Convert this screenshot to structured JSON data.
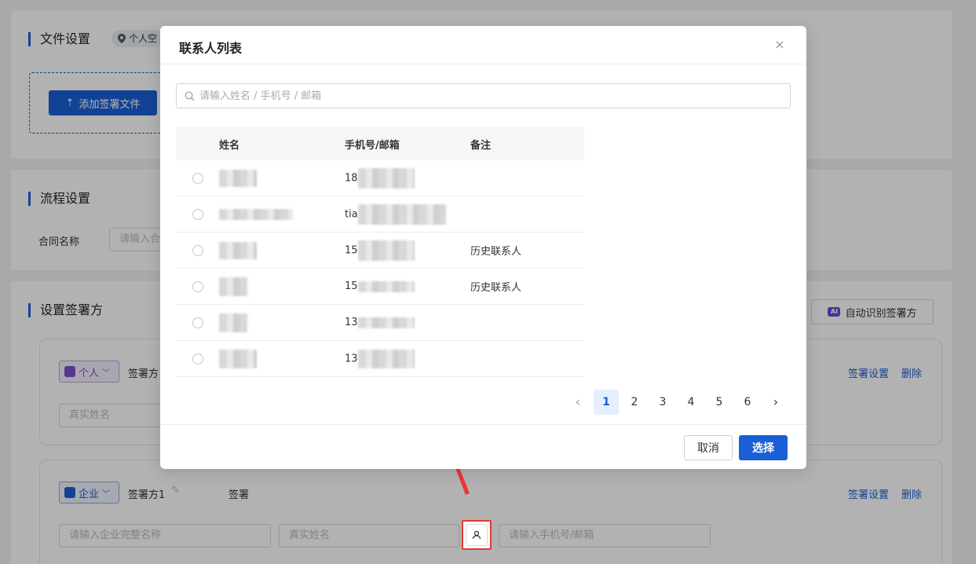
{
  "background": {
    "file_settings": {
      "title": "文件设置",
      "location_tag": "个人空",
      "add_file_button": "添加签署文件"
    },
    "flow_settings": {
      "title": "流程设置",
      "contract_name_label": "合同名称",
      "contract_name_placeholder": "请输入合"
    },
    "signers": {
      "title": "设置签署方",
      "auto_detect_button": "自动识别签署方",
      "ai_badge": "AI",
      "person_block": {
        "type": "个人",
        "label": "签署方",
        "name_placeholder": "真实姓名",
        "settings_link": "签署设置",
        "delete_link": "删除"
      },
      "company_block": {
        "type": "企业",
        "label": "签署方1",
        "sign_label": "签署",
        "company_placeholder": "请输入企业完整名称",
        "name_placeholder": "真实姓名",
        "contact_placeholder": "请输入手机号/邮箱",
        "settings_link": "签署设置",
        "delete_link": "删除"
      }
    }
  },
  "modal": {
    "title": "联系人列表",
    "close": "×",
    "search_placeholder": "请输入姓名 / 手机号 / 邮箱",
    "columns": [
      "姓名",
      "手机号/邮箱",
      "备注"
    ],
    "rows": [
      {
        "phone_prefix": "18",
        "note": ""
      },
      {
        "phone_prefix": "tia",
        "note": ""
      },
      {
        "phone_prefix": "15",
        "note": "历史联系人"
      },
      {
        "phone_prefix": "15",
        "note": "历史联系人"
      },
      {
        "phone_prefix": "13",
        "note": ""
      },
      {
        "phone_prefix": "13",
        "note": ""
      }
    ],
    "pagination": {
      "prev": "‹",
      "pages": [
        "1",
        "2",
        "3",
        "4",
        "5",
        "6"
      ],
      "current": "1",
      "next": "›"
    },
    "cancel_button": "取消",
    "confirm_button": "选择"
  },
  "colors": {
    "primary": "#1a5fd6",
    "annotation_red": "#e53935"
  }
}
